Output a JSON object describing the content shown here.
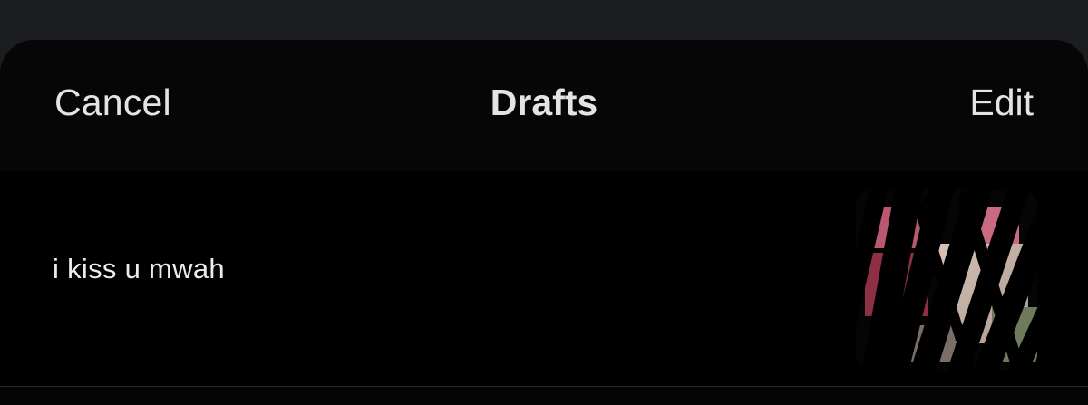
{
  "header": {
    "cancel_label": "Cancel",
    "title": "Drafts",
    "edit_label": "Edit"
  },
  "drafts": [
    {
      "text": "i kiss u mwah",
      "thumbnail": "redacted-photo"
    }
  ],
  "colors": {
    "backdrop": "#1c1d21",
    "sheet": "#050505",
    "text": "#e4e4e6",
    "divider": "#2a2a2e"
  }
}
